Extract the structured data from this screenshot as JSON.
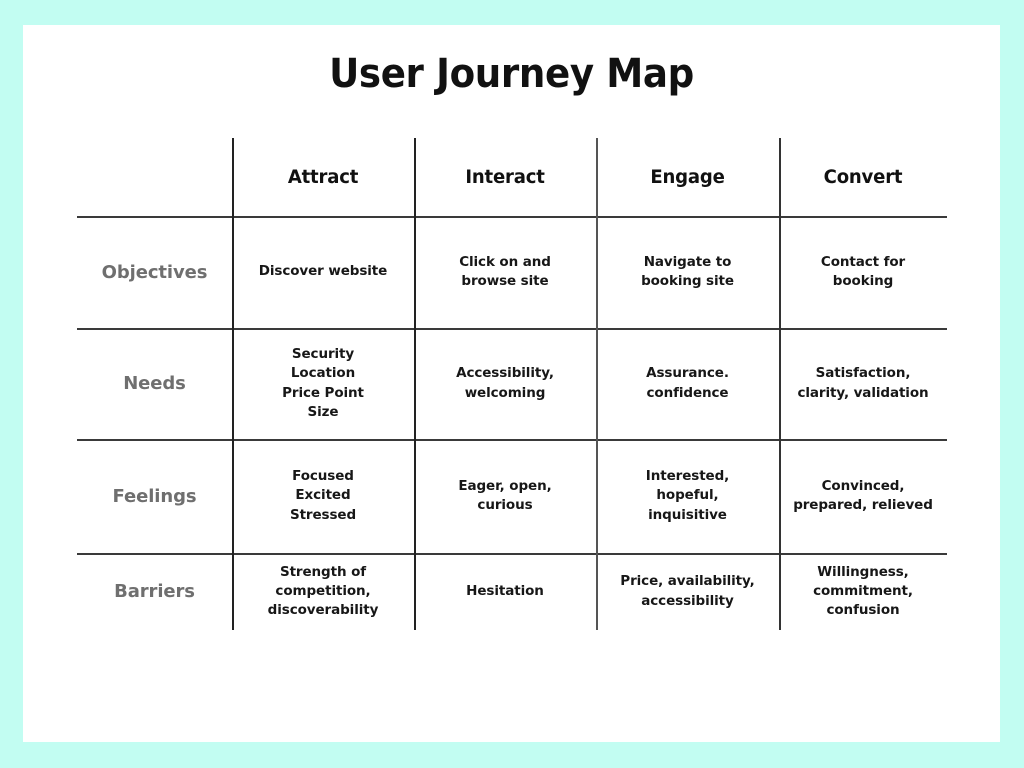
{
  "theme": {
    "background_color": "#c2fdf2",
    "sheet_color": "#ffffff",
    "rule_color": "#3a3a3a",
    "title_color": "#111111",
    "row_label_color": "#6f6f6f",
    "cell_text_color": "#171717"
  },
  "title": "User Journey Map",
  "table": {
    "corner_label": "",
    "columns": [
      "Attract",
      "Interact",
      "Engage",
      "Convert"
    ],
    "rows": [
      {
        "label": "Objectives",
        "cells": [
          "Discover website",
          "Click on and\nbrowse site",
          "Navigate to\nbooking site",
          "Contact for\nbooking"
        ]
      },
      {
        "label": "Needs",
        "cells": [
          "Security\nLocation\nPrice Point\nSize",
          "Accessibility,\nwelcoming",
          "Assurance.\nconfidence",
          "Satisfaction,\nclarity, validation"
        ]
      },
      {
        "label": "Feelings",
        "cells": [
          "Focused\nExcited\nStressed",
          "Eager, open,\ncurious",
          "Interested,\nhopeful,\ninquisitive",
          "Convinced,\nprepared, relieved"
        ]
      },
      {
        "label": "Barriers",
        "cells": [
          "Strength of\ncompetition,\ndiscoverability",
          "Hesitation",
          "Price, availability,\naccessibility",
          "Willingness,\ncommitment,\nconfusion"
        ]
      }
    ]
  }
}
